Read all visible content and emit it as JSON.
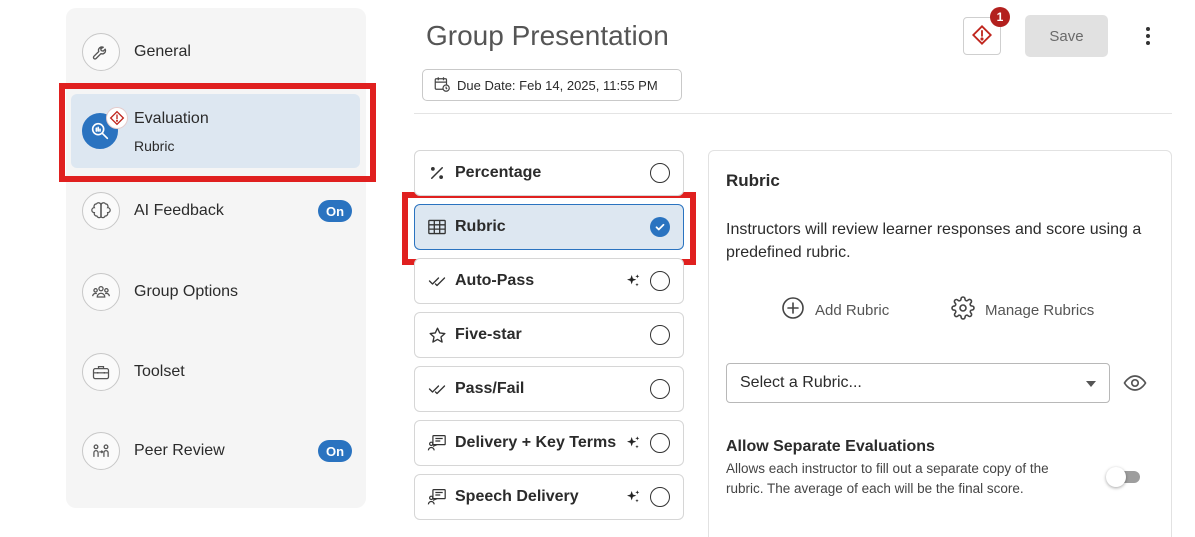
{
  "sidebar": {
    "items": [
      {
        "label": "General",
        "icon": "wrench-icon"
      },
      {
        "label": "Evaluation",
        "sub": "Rubric",
        "icon": "evaluation-icon",
        "active": true,
        "warning": true
      },
      {
        "label": "AI Feedback",
        "icon": "brain-icon",
        "badge": "On"
      },
      {
        "label": "Group Options",
        "icon": "group-icon"
      },
      {
        "label": "Toolset",
        "icon": "toolbox-icon"
      },
      {
        "label": "Peer Review",
        "icon": "peer-review-icon",
        "badge": "On"
      }
    ]
  },
  "header": {
    "title": "Group Presentation",
    "due_date": "Due Date: Feb 14, 2025, 11:55 PM",
    "alert_count": "1",
    "save_label": "Save"
  },
  "options": [
    {
      "label": "Percentage",
      "icon": "percent-icon",
      "ai": false,
      "selected": false
    },
    {
      "label": "Rubric",
      "icon": "grid-icon",
      "ai": false,
      "selected": true
    },
    {
      "label": "Auto-Pass",
      "icon": "double-check-icon",
      "ai": true,
      "selected": false
    },
    {
      "label": "Five-star",
      "icon": "star-icon",
      "ai": false,
      "selected": false
    },
    {
      "label": "Pass/Fail",
      "icon": "double-check-icon",
      "ai": false,
      "selected": false
    },
    {
      "label": "Delivery + Key Terms",
      "icon": "presentation-icon",
      "ai": true,
      "selected": false
    },
    {
      "label": "Speech Delivery",
      "icon": "presentation-icon",
      "ai": true,
      "selected": false
    }
  ],
  "panel": {
    "title": "Rubric",
    "description": "Instructors will review learner responses and score using a predefined rubric.",
    "add_rubric": "Add Rubric",
    "manage_rubrics": "Manage Rubrics",
    "select_placeholder": "Select a Rubric...",
    "separate_title": "Allow Separate Evaluations",
    "separate_desc": "Allows each instructor to fill out a separate copy of the rubric. The average of each will be the final score.",
    "separate_enabled": false
  },
  "colors": {
    "accent": "#2a73c0",
    "highlight_box": "#e0201f",
    "alert": "#b3201e",
    "selected_bg": "#dde7f1"
  }
}
